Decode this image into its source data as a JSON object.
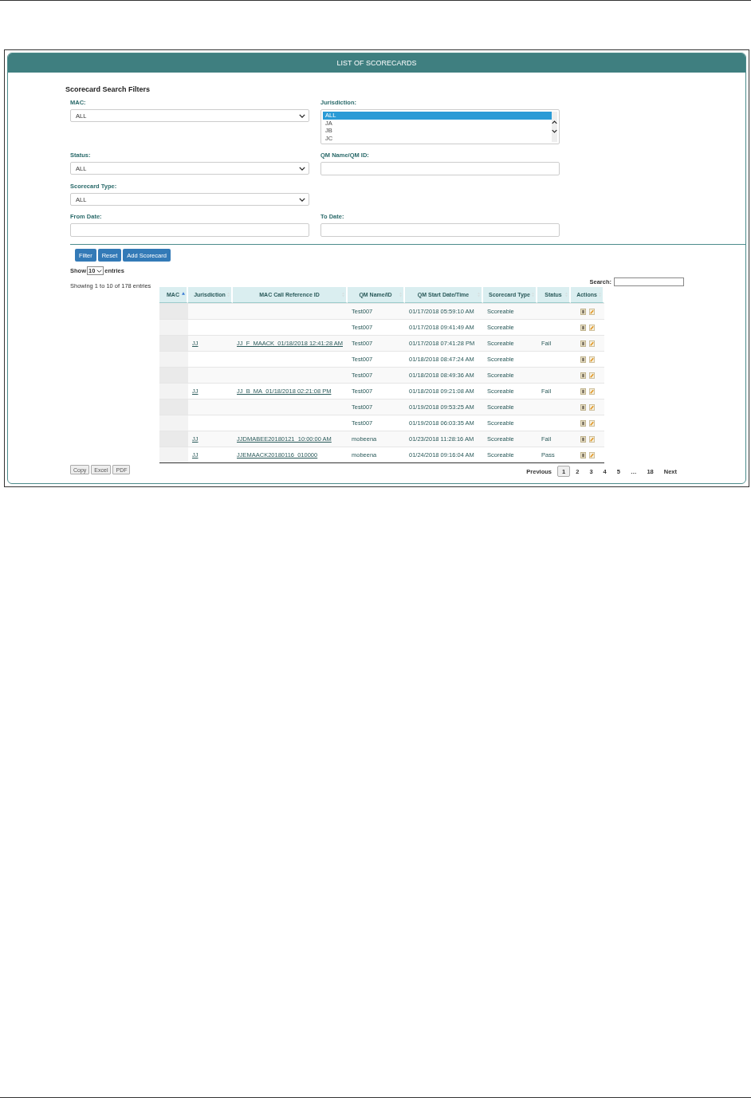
{
  "panel": {
    "title": "LIST OF SCORECARDS"
  },
  "filters": {
    "heading": "Scorecard Search Filters",
    "rows": [
      [
        {
          "kind": "select",
          "label": "MAC:",
          "value": "ALL"
        },
        {
          "kind": "listbox",
          "label": "Jurisdiction:",
          "options": [
            {
              "label": "ALL",
              "selected": true
            },
            {
              "label": "JA",
              "selected": false
            },
            {
              "label": "JB",
              "selected": false
            },
            {
              "label": "JC",
              "selected": false
            }
          ]
        }
      ],
      [
        {
          "kind": "select",
          "label": "Status:",
          "value": "ALL"
        },
        {
          "kind": "text",
          "label": "QM Name/QM ID:"
        }
      ],
      [
        {
          "kind": "select",
          "label": "Scorecard Type:",
          "value": "ALL"
        }
      ],
      [
        {
          "kind": "text",
          "label": "From Date:"
        },
        {
          "kind": "text",
          "label": "To Date:"
        }
      ]
    ]
  },
  "buttons": [
    "Filter",
    "Reset",
    "Add Scorecard"
  ],
  "length": {
    "label_before": "Show",
    "value": "10",
    "label_after": "entries"
  },
  "info": "Showing 1 to 10 of 178 entries",
  "search": {
    "label": "Search:"
  },
  "table": {
    "columns": [
      {
        "label": "MAC",
        "sorted": true
      },
      {
        "label": "Jurisdiction",
        "sorted": false
      },
      {
        "label": "MAC Call Reference ID",
        "sorted": false
      },
      {
        "label": "QM Name/ID",
        "sorted": false
      },
      {
        "label": "QM Start Date/Time",
        "sorted": false
      },
      {
        "label": "Scorecard Type",
        "sorted": false
      },
      {
        "label": "Status",
        "sorted": false
      },
      {
        "label": "Actions",
        "sorted": false
      }
    ],
    "rows": [
      {
        "qm": "Test007",
        "start": "01/17/2018 05:59:10 AM",
        "type": "Scoreable"
      },
      {
        "qm": "Test007",
        "start": "01/17/2018 09:41:49 AM",
        "type": "Scoreable"
      },
      {
        "jurisdiction": "JJ",
        "reference": "JJ_F_MAACK_01/18/2018 12:41:28 AM",
        "qm": "Test007",
        "start": "01/17/2018 07:41:28 PM",
        "type": "Scoreable",
        "status": "Fail"
      },
      {
        "qm": "Test007",
        "start": "01/18/2018 08:47:24 AM",
        "type": "Scoreable"
      },
      {
        "qm": "Test007",
        "start": "01/18/2018 08:49:36 AM",
        "type": "Scoreable"
      },
      {
        "jurisdiction": "JJ",
        "reference": "JJ_B_MA_01/18/2018 02:21:08 PM",
        "qm": "Test007",
        "start": "01/18/2018 09:21:08 AM",
        "type": "Scoreable",
        "status": "Fail"
      },
      {
        "qm": "Test007",
        "start": "01/19/2018 09:53:25 AM",
        "type": "Scoreable"
      },
      {
        "qm": "Test007",
        "start": "01/19/2018 06:03:35 AM",
        "type": "Scoreable"
      },
      {
        "jurisdiction": "JJ",
        "reference": "JJDMABEE20180121_10:00:00 AM",
        "qm": "mobeena",
        "start": "01/23/2018 11:28:16 AM",
        "type": "Scoreable",
        "status": "Fail"
      },
      {
        "jurisdiction": "JJ",
        "reference": "JJEMAACK20180116_010000",
        "qm": "mobeena",
        "start": "01/24/2018 09:16:04 AM",
        "type": "Scoreable",
        "status": "Pass"
      }
    ]
  },
  "exports": [
    "Copy",
    "Excel",
    "PDF"
  ],
  "pagination": {
    "previous": "Previous",
    "pages": [
      {
        "label": "1",
        "selected": true
      },
      {
        "label": "2",
        "selected": false
      },
      {
        "label": "3",
        "selected": false
      },
      {
        "label": "4",
        "selected": false
      },
      {
        "label": "5",
        "selected": false
      },
      {
        "label": "…",
        "selected": false
      },
      {
        "label": "18",
        "selected": false
      }
    ],
    "next": "Next"
  }
}
